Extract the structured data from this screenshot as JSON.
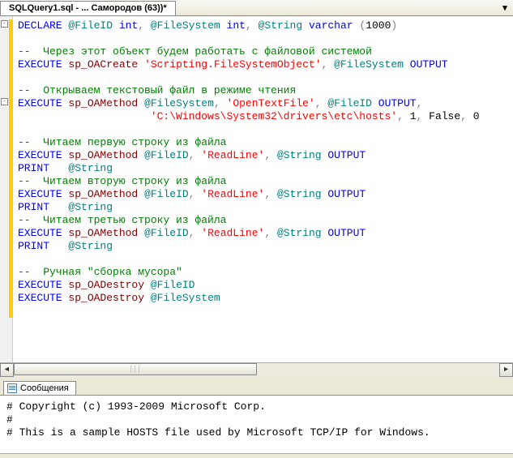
{
  "tab": {
    "title": "SQLQuery1.sql - ... Самородов (63))*",
    "close_glyph": "▾"
  },
  "gutter": {
    "fold1_line": 1,
    "fold2_line": 7,
    "yellow_ranges": [
      [
        1,
        7
      ],
      [
        7,
        24
      ]
    ]
  },
  "code": {
    "l1_declare": "DECLARE",
    "l1_fileid": "@FileID",
    "l1_int1": "int",
    "l1_comma1": ",",
    "l1_filesystem": "@FileSystem",
    "l1_int2": "int",
    "l1_comma2": ",",
    "l1_string": "@String",
    "l1_varchar": "varchar",
    "l1_paren_open": "(",
    "l1_num": "1000",
    "l1_paren_close": ")",
    "l2_blank": "",
    "l3_comment": "--  Через этот объект будем работать с файловой системой",
    "l4_exec": "EXECUTE",
    "l4_proc": "sp_OACreate",
    "l4_str": "'Scripting.FileSystemObject'",
    "l4_comma": ",",
    "l4_var": "@FileSystem",
    "l4_out": "OUTPUT",
    "l5_blank": "",
    "l6_comment": "--  Открываем текстовый файл в режиме чтения",
    "l7_exec": "EXECUTE",
    "l7_proc": "sp_OAMethod",
    "l7_var1": "@FileSystem",
    "l7_c1": ",",
    "l7_str": "'OpenTextFile'",
    "l7_c2": ",",
    "l7_var2": "@FileID",
    "l7_out": "OUTPUT",
    "l7_c3": ",",
    "l8_pad": "                     ",
    "l8_str": "'C:\\Windows\\System32\\drivers\\etc\\hosts'",
    "l8_c1": ",",
    "l8_n1": "1",
    "l8_c2": ",",
    "l8_false": "False",
    "l8_c3": ",",
    "l8_n2": "0",
    "l9_blank": "",
    "l10_comment": "--  Читаем первую строку из файла",
    "l11_exec": "EXECUTE",
    "l11_proc": "sp_OAMethod",
    "l11_var1": "@FileID",
    "l11_c1": ",",
    "l11_str": "'ReadLine'",
    "l11_c2": ",",
    "l11_var2": "@String",
    "l11_out": "OUTPUT",
    "l12_print": "PRINT",
    "l12_pad": "   ",
    "l12_var": "@String",
    "l13_comment": "--  Читаем вторую строку из файла",
    "l14_exec": "EXECUTE",
    "l14_proc": "sp_OAMethod",
    "l14_var1": "@FileID",
    "l14_c1": ",",
    "l14_str": "'ReadLine'",
    "l14_c2": ",",
    "l14_var2": "@String",
    "l14_out": "OUTPUT",
    "l15_print": "PRINT",
    "l15_pad": "   ",
    "l15_var": "@String",
    "l16_comment": "--  Читаем третью строку из файла",
    "l17_exec": "EXECUTE",
    "l17_proc": "sp_OAMethod",
    "l17_var1": "@FileID",
    "l17_c1": ",",
    "l17_str": "'ReadLine'",
    "l17_c2": ",",
    "l17_var2": "@String",
    "l17_out": "OUTPUT",
    "l18_print": "PRINT",
    "l18_pad": "   ",
    "l18_var": "@String",
    "l19_blank": "",
    "l20_comment": "--  Ручная \"сборка мусора\"",
    "l21_exec": "EXECUTE",
    "l21_proc": "sp_OADestroy",
    "l21_var": "@FileID",
    "l22_exec": "EXECUTE",
    "l22_proc": "sp_OADestroy",
    "l22_var": "@FileSystem"
  },
  "messages_tab": {
    "label": "Сообщения"
  },
  "messages": {
    "l1": "# Copyright (c) 1993-2009 Microsoft Corp.",
    "l2": "#",
    "l3": "# This is a sample HOSTS file used by Microsoft TCP/IP for Windows."
  },
  "scroll": {
    "left_arrow": "◄",
    "right_arrow": "►",
    "grip": "│││"
  }
}
